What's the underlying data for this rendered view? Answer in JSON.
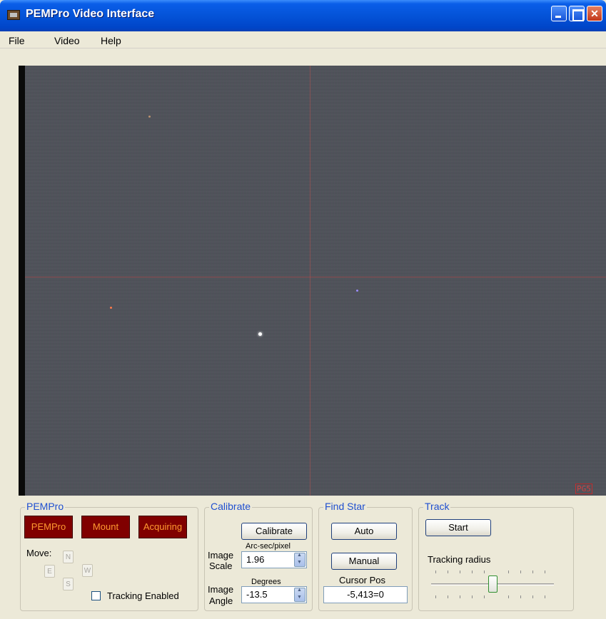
{
  "window": {
    "title": "PEMPro Video Interface"
  },
  "menu": {
    "items": [
      "File",
      "Video",
      "Help"
    ]
  },
  "video": {
    "corner_mark": "PG5"
  },
  "pempro_group": {
    "title": "PEMPro",
    "buttons": [
      "PEMPro",
      "Mount",
      "Acquiring"
    ],
    "move_label": "Move:",
    "directions": {
      "n": "N",
      "e": "E",
      "w": "W",
      "s": "S"
    },
    "tracking_enabled_label": "Tracking Enabled",
    "tracking_enabled_checked": false
  },
  "calibrate_group": {
    "title": "Calibrate",
    "calibrate_button": "Calibrate",
    "scale_unit_label": "Arc-sec/pixel",
    "image_scale_label_line1": "Image",
    "image_scale_label_line2": "Scale",
    "image_scale_value": "1.96",
    "angle_unit_label": "Degrees",
    "image_angle_label_line1": "Image",
    "image_angle_label_line2": "Angle",
    "image_angle_value": "-13.5"
  },
  "find_star_group": {
    "title": "Find Star",
    "auto_button": "Auto",
    "manual_button": "Manual",
    "cursor_pos_label": "Cursor Pos",
    "cursor_pos_value": "-5,413=0"
  },
  "track_group": {
    "title": "Track",
    "start_button": "Start",
    "tracking_radius_label": "Tracking radius",
    "tracking_radius_fraction": 0.5
  },
  "colors": {
    "title_bar": "#0453d8",
    "group_title": "#1f4fd0",
    "status_button_bg": "#800000",
    "status_button_text": "#ff9a30"
  }
}
